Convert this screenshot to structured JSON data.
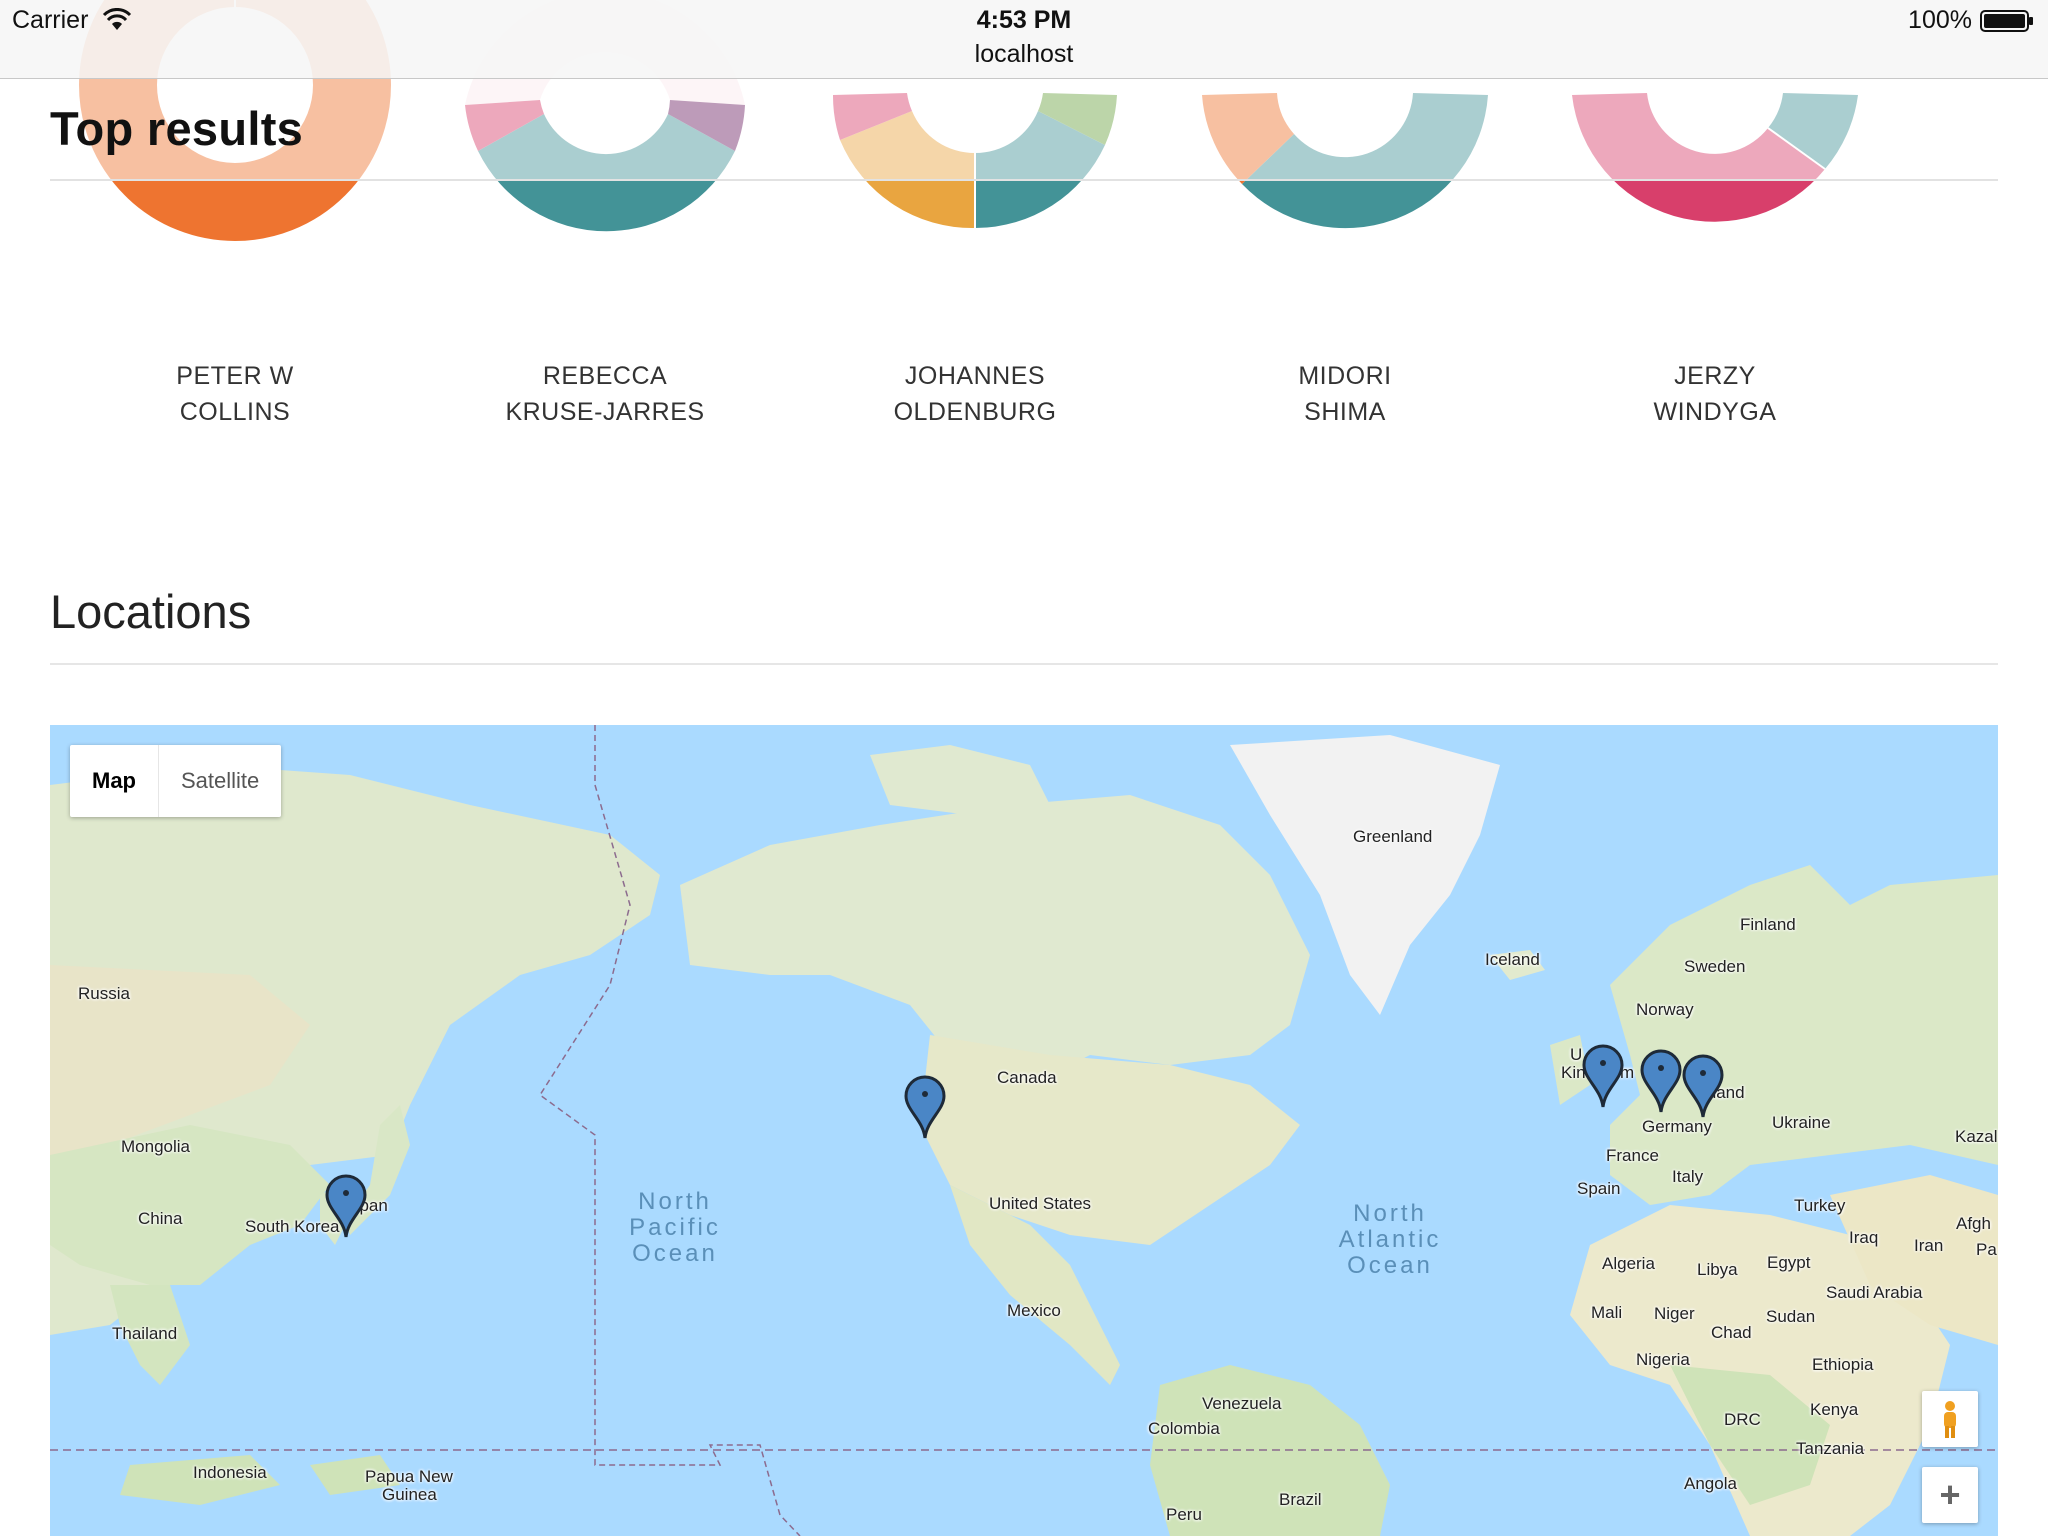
{
  "status_bar": {
    "carrier": "Carrier",
    "time": "4:53 PM",
    "url": "localhost",
    "battery": "100%"
  },
  "top_results": {
    "heading": "Top results",
    "people": [
      {
        "line1": "PETER W",
        "line2": "COLLINS"
      },
      {
        "line1": "REBECCA",
        "line2": "KRUSE-JARRES"
      },
      {
        "line1": "JOHANNES",
        "line2": "OLDENBURG"
      },
      {
        "line1": "MIDORI",
        "line2": "SHIMA"
      },
      {
        "line1": "JERZY",
        "line2": "WINDYGA"
      }
    ]
  },
  "colors": {
    "orange": "#ee7430",
    "teal": "#439397",
    "pink": "#d83f6b",
    "purple": "#6e2265",
    "yellow": "#e9a540",
    "green": "#6aa342",
    "map_water": "#aadaff",
    "marker": "#4a86c6"
  },
  "locations": {
    "heading": "Locations",
    "map_type": {
      "map": "Map",
      "satellite": "Satellite",
      "selected": "Map"
    },
    "labels": {
      "greenland": "Greenland",
      "iceland": "Iceland",
      "finland": "Finland",
      "sweden": "Sweden",
      "norway": "Norway",
      "uk_a": "U",
      "uk_b": "Kin",
      "uk_c": "m",
      "poland": "oland",
      "germany": "Germany",
      "ukraine": "Ukraine",
      "kazakh": "Kazal",
      "france": "France",
      "italy": "Italy",
      "spain": "Spain",
      "turkey": "Turkey",
      "iraq": "Iraq",
      "iran": "Iran",
      "afgh": "Afgh",
      "pa": "Pa",
      "algeria": "Algeria",
      "libya": "Libya",
      "egypt": "Egypt",
      "saudi": "Saudi Arabia",
      "mali": "Mali",
      "niger": "Niger",
      "sudan": "Sudan",
      "chad": "Chad",
      "nigeria": "Nigeria",
      "ethiopia": "Ethiopia",
      "kenya": "Kenya",
      "drc": "DRC",
      "tanzania": "Tanzania",
      "angola": "Angola",
      "russia": "Russia",
      "mongolia": "Mongolia",
      "china": "China",
      "south_korea": "South Korea",
      "japan": "apan",
      "thailand": "Thailand",
      "indonesia": "Indonesia",
      "png_1": "Papua New",
      "png_2": "Guinea",
      "canada": "Canada",
      "usa": "United States",
      "mexico": "Mexico",
      "venezuela": "Venezuela",
      "colombia": "Colombia",
      "brazil": "Brazil",
      "peru": "Peru"
    },
    "oceans": {
      "north_pacific": [
        "North",
        "Pacific",
        "Ocean"
      ],
      "north_atlantic": [
        "North",
        "Atlantic",
        "Ocean"
      ]
    },
    "markers": [
      "Japan",
      "Vancouver",
      "United Kingdom",
      "Germany",
      "Poland"
    ]
  }
}
